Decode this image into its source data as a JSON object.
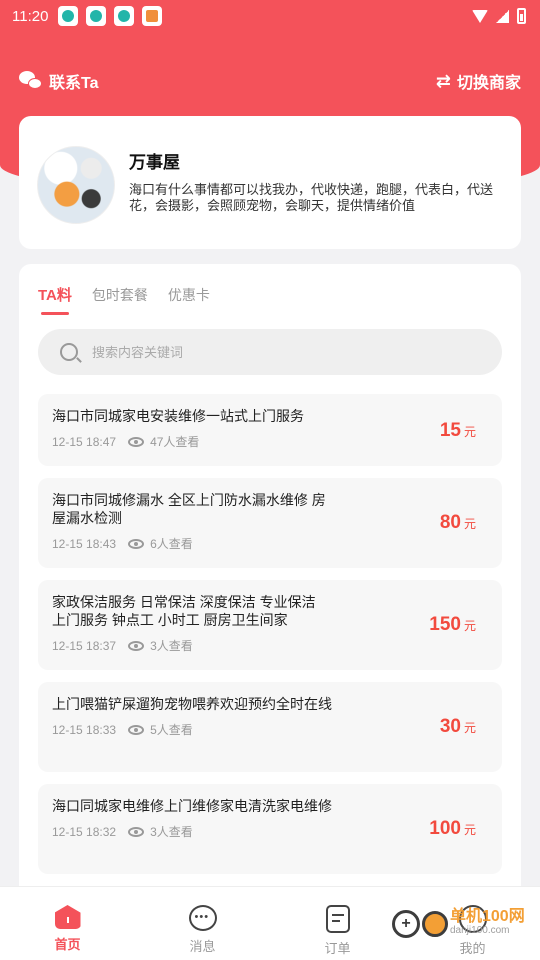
{
  "status_bar": {
    "time": "11:20",
    "notifications": [
      "app-notification-icon",
      "app-notification-icon",
      "app-notification-icon",
      "heart-app-icon"
    ]
  },
  "topbar": {
    "contact_label": "联系Ta",
    "switch_label": "切换商家"
  },
  "profile": {
    "name": "万事屋",
    "description": "海口有什么事情都可以找我办，代收快递，跑腿，代表白，代送花，会摄影，会照顾宠物，会聊天，提供情绪价值"
  },
  "tabs": [
    {
      "label": "TA料",
      "active": true
    },
    {
      "label": "包时套餐",
      "active": false
    },
    {
      "label": "优惠卡",
      "active": false
    }
  ],
  "search": {
    "placeholder": "搜索内容关键词"
  },
  "items": [
    {
      "title": "海口市同城家电安装维修一站式上门服务",
      "date": "12-15 18:47",
      "views": "47人查看",
      "price": "15",
      "unit": "元"
    },
    {
      "title": "海口市同城修漏水 全区上门防水漏水维修 房屋漏水检测",
      "date": "12-15 18:43",
      "views": "6人查看",
      "price": "80",
      "unit": "元"
    },
    {
      "title": "家政保洁服务 日常保洁 深度保洁 专业保洁 上门服务 钟点工 小时工 厨房卫生间家",
      "date": "12-15 18:37",
      "views": "3人查看",
      "price": "150",
      "unit": "元"
    },
    {
      "title": "上门喂猫铲屎遛狗宠物喂养欢迎预约全时在线",
      "date": "12-15 18:33",
      "views": "5人查看",
      "price": "30",
      "unit": "元"
    },
    {
      "title": "海口同城家电维修上门维修家电清洗家电维修",
      "date": "12-15 18:32",
      "views": "3人查看",
      "price": "100",
      "unit": "元"
    }
  ],
  "bottom_nav": [
    {
      "label": "首页",
      "icon": "home-icon",
      "active": true
    },
    {
      "label": "消息",
      "icon": "message-icon",
      "active": false
    },
    {
      "label": "订单",
      "icon": "order-icon",
      "active": false
    },
    {
      "label": "我的",
      "icon": "profile-icon",
      "active": false
    }
  ],
  "watermark": {
    "text": "单机100网",
    "subtext": "danji100.com"
  },
  "colors": {
    "brand": "#f4525a",
    "price": "#f24a3e"
  }
}
